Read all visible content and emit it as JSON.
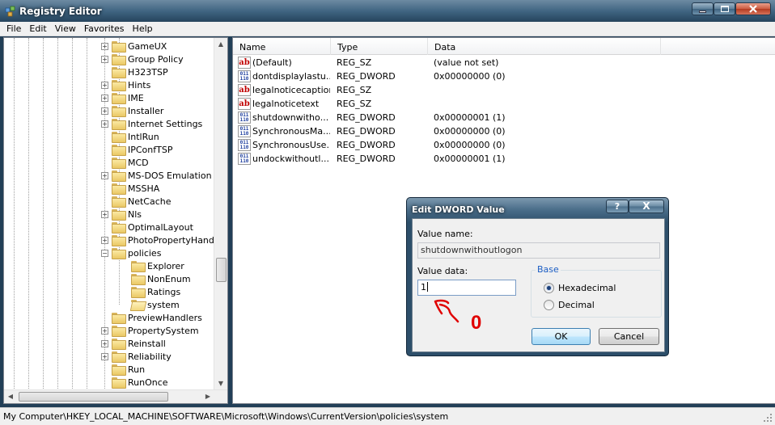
{
  "window": {
    "title": "Registry Editor",
    "app_icon": "registry-editor-icon"
  },
  "menu": [
    "File",
    "Edit",
    "View",
    "Favorites",
    "Help"
  ],
  "tree": {
    "items": [
      {
        "label": "GameUX",
        "expander": "+"
      },
      {
        "label": "Group Policy",
        "expander": "+"
      },
      {
        "label": "H323TSP",
        "expander": ""
      },
      {
        "label": "Hints",
        "expander": "+"
      },
      {
        "label": "IME",
        "expander": "+"
      },
      {
        "label": "Installer",
        "expander": "+"
      },
      {
        "label": "Internet Settings",
        "expander": "+"
      },
      {
        "label": "IntlRun",
        "expander": ""
      },
      {
        "label": "IPConfTSP",
        "expander": ""
      },
      {
        "label": "MCD",
        "expander": ""
      },
      {
        "label": "MS-DOS Emulation",
        "expander": "+"
      },
      {
        "label": "MSSHA",
        "expander": ""
      },
      {
        "label": "NetCache",
        "expander": ""
      },
      {
        "label": "Nls",
        "expander": "+"
      },
      {
        "label": "OptimalLayout",
        "expander": ""
      },
      {
        "label": "PhotoPropertyHand",
        "expander": "+"
      },
      {
        "label": "policies",
        "expander": "−"
      },
      {
        "label": "Explorer",
        "expander": "",
        "child": true
      },
      {
        "label": "NonEnum",
        "expander": "",
        "child": true
      },
      {
        "label": "Ratings",
        "expander": "",
        "child": true
      },
      {
        "label": "system",
        "expander": "",
        "child": true,
        "open": true
      },
      {
        "label": "PreviewHandlers",
        "expander": ""
      },
      {
        "label": "PropertySystem",
        "expander": "+"
      },
      {
        "label": "Reinstall",
        "expander": "+"
      },
      {
        "label": "Reliability",
        "expander": "+"
      },
      {
        "label": "Run",
        "expander": ""
      },
      {
        "label": "RunOnce",
        "expander": ""
      }
    ]
  },
  "list": {
    "columns": [
      "Name",
      "Type",
      "Data"
    ],
    "rows": [
      {
        "icon": "string-value-icon",
        "name": "(Default)",
        "type": "REG_SZ",
        "data": "(value not set)"
      },
      {
        "icon": "dword-value-icon",
        "name": "dontdisplaylastu...",
        "type": "REG_DWORD",
        "data": "0x00000000 (0)"
      },
      {
        "icon": "string-value-icon",
        "name": "legalnoticecaption",
        "type": "REG_SZ",
        "data": ""
      },
      {
        "icon": "string-value-icon",
        "name": "legalnoticetext",
        "type": "REG_SZ",
        "data": ""
      },
      {
        "icon": "dword-value-icon",
        "name": "shutdownwithо...",
        "type": "REG_DWORD",
        "data": "0x00000001 (1)"
      },
      {
        "icon": "dword-value-icon",
        "name": "SynchronousMa...",
        "type": "REG_DWORD",
        "data": "0x00000000 (0)"
      },
      {
        "icon": "dword-value-icon",
        "name": "SynchronousUse...",
        "type": "REG_DWORD",
        "data": "0x00000000 (0)"
      },
      {
        "icon": "dword-value-icon",
        "name": "undockwithoutl...",
        "type": "REG_DWORD",
        "data": "0x00000001 (1)"
      }
    ]
  },
  "status": "My Computer\\HKEY_LOCAL_MACHINE\\SOFTWARE\\Microsoft\\Windows\\CurrentVersion\\policies\\system",
  "dialog": {
    "title": "Edit DWORD Value",
    "help_label": "?",
    "close_label": "X",
    "value_name_label": "Value name:",
    "value_name": "shutdownwithoutlogon",
    "value_data_label": "Value data:",
    "value_data": "1",
    "base_label": "Base",
    "hex_label": "Hexadecimal",
    "dec_label": "Decimal",
    "selected_base": "Hexadecimal",
    "ok_label": "OK",
    "cancel_label": "Cancel"
  },
  "annotation": {
    "text": "0",
    "color": "#e00000"
  }
}
